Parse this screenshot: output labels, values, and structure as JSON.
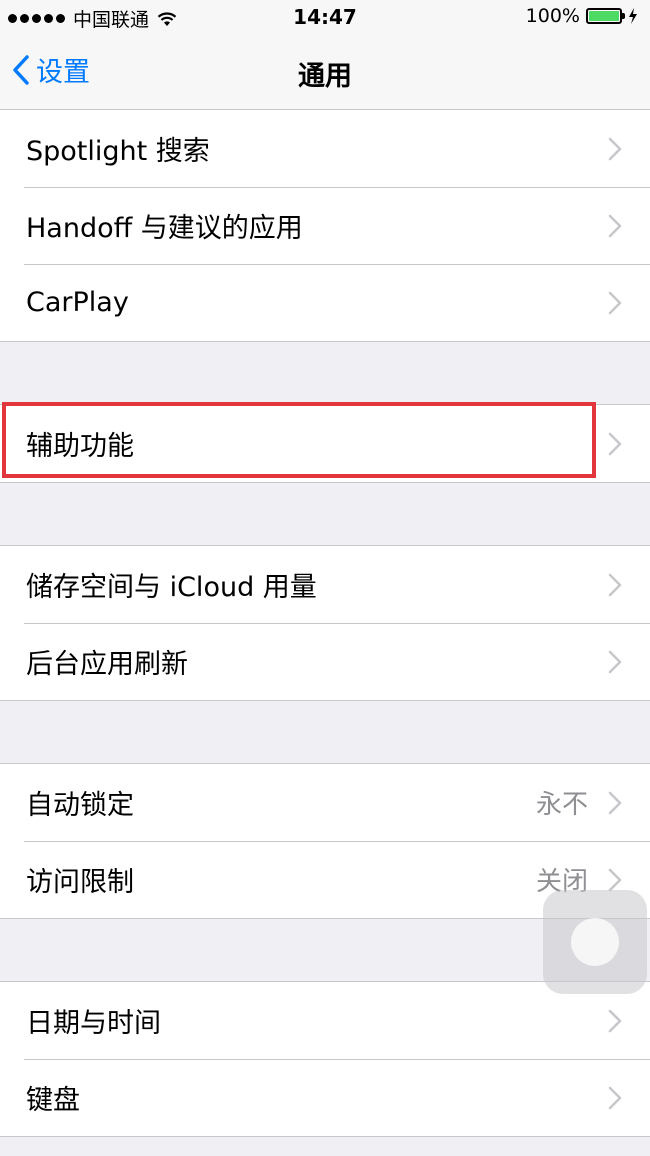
{
  "status_bar": {
    "carrier": "中国联通",
    "time": "14:47",
    "battery_percent": "100%",
    "battery_level": 1.0,
    "battery_color": "#4cd964"
  },
  "nav": {
    "back_label": "设置",
    "title": "通用",
    "accent": "#007aff"
  },
  "groups": [
    {
      "rows": [
        {
          "label": "Spotlight 搜索"
        },
        {
          "label": "Handoff 与建议的应用"
        },
        {
          "label": "CarPlay"
        }
      ]
    },
    {
      "rows": [
        {
          "label": "辅助功能",
          "highlighted": true
        }
      ]
    },
    {
      "rows": [
        {
          "label": "储存空间与 iCloud 用量"
        },
        {
          "label": "后台应用刷新"
        }
      ]
    },
    {
      "rows": [
        {
          "label": "自动锁定",
          "value": "永不"
        },
        {
          "label": "访问限制",
          "value": "关闭"
        }
      ]
    },
    {
      "rows": [
        {
          "label": "日期与时间"
        },
        {
          "label": "键盘"
        }
      ]
    }
  ],
  "highlight_color": "#e0363c",
  "icons": [
    "signal-icon",
    "wifi-icon",
    "battery-icon",
    "charging-icon",
    "back-chevron-icon",
    "chevron-right-icon",
    "assistive-touch-icon"
  ]
}
